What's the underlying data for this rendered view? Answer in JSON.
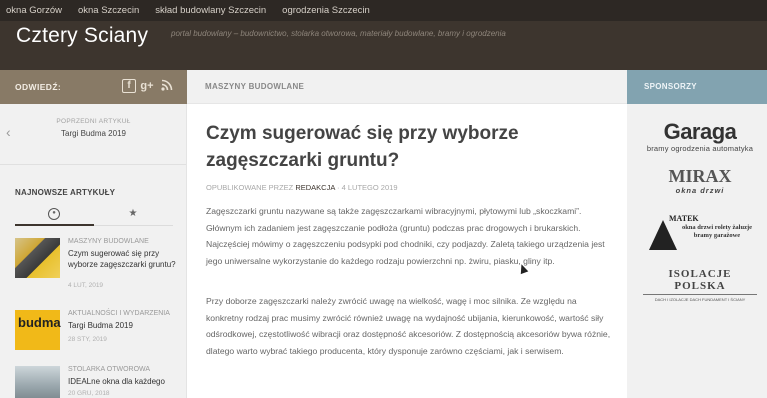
{
  "topnav": {
    "links": [
      "okna Gorzów",
      "okna Szczecin",
      "skład budowlany Szczecin",
      "ogrodzenia Szczecin"
    ]
  },
  "header": {
    "site_title": "Cztery Sciany",
    "site_description": "portal budowlany – budownictwo, stolarka otworowa, materiały budowlane, bramy i ogrodzenia"
  },
  "left_sidebar": {
    "visit_label": "ODWIEDŹ:",
    "social_icons": [
      "facebook-icon",
      "google-plus-icon",
      "rss-icon"
    ],
    "previous_label": "POPRZEDNI ARTYKUŁ",
    "previous_title": "Targi Budma 2019",
    "newest_heading": "NAJNOWSZE ARTYKUŁY",
    "posts": [
      {
        "category": "MASZYNY BUDOWLANE",
        "title": "Czym sugerować się przy wyborze zagęszczarki gruntu?",
        "date": "4 LUT, 2019"
      },
      {
        "category": "AKTUALNOŚCI I WYDARZENIA",
        "title": "Targi Budma 2019",
        "date": "28 STY, 2019",
        "thumb_text": "budma"
      },
      {
        "category": "STOLARKA OTWOROWA",
        "title": "IDEALne okna dla każdego",
        "date": "20 GRU, 2018"
      }
    ]
  },
  "main": {
    "category_label": "MASZYNY BUDOWLANE",
    "title": "Czym sugerować się przy wyborze zagęszczarki gruntu?",
    "meta_prefix": "OPUBLIKOWANE PRZEZ",
    "meta_author": "REDAKCJA",
    "meta_date": "· 4 LUTEGO 2019",
    "paragraph1": "Zagęszczarki gruntu nazywane są także zagęszczarkami wibracyjnymi, płytowymi lub „skoczkami”. Głównym ich zadaniem jest zagęszczanie podłoża (gruntu) podczas prac drogowych i brukarskich. Najczęściej mówimy o zagęszczeniu podsypki pod chodniki, czy podjazdy. Zaletą takiego urządzenia jest jego uniwersalne wykorzystanie do każdego rodzaju powierzchni np. żwiru, piasku, gliny itp.",
    "paragraph2": "Przy doborze zagęszczarki należy zwrócić uwagę na wielkość, wagę i moc silnika. Ze względu na konkretny rodzaj prac musimy zwrócić również uwagę na wydajność ubijania, kierunkowość, wartość siły odśrodkowej, częstotliwość wibracji oraz dostępność akcesoriów. Z dostępnością akcesoriów bywa różnie, dlatego warto wybrać takiego producenta, który dysponuje zarówno częściami, jak i serwisem."
  },
  "right_sidebar": {
    "heading": "SPONSORZY",
    "sponsors": [
      {
        "name": "Garaga",
        "tagline": "bramy ogrodzenia automatyka"
      },
      {
        "name": "MIRAX",
        "tagline": "okna drzwi"
      },
      {
        "name": "MATEK",
        "tagline": "okna drzwi rolety żaluzje bramy garażowe"
      },
      {
        "name": "ISOLACJE POLSKA",
        "tagline": "DACH I IZOLACJE DACH FUNDAMENT I ŚCIANY"
      }
    ]
  },
  "colors": {
    "topnav_bg": "#2d2824",
    "header_bg": "#3d352e",
    "left_accent": "#887a66",
    "right_accent": "#82a3b0"
  }
}
